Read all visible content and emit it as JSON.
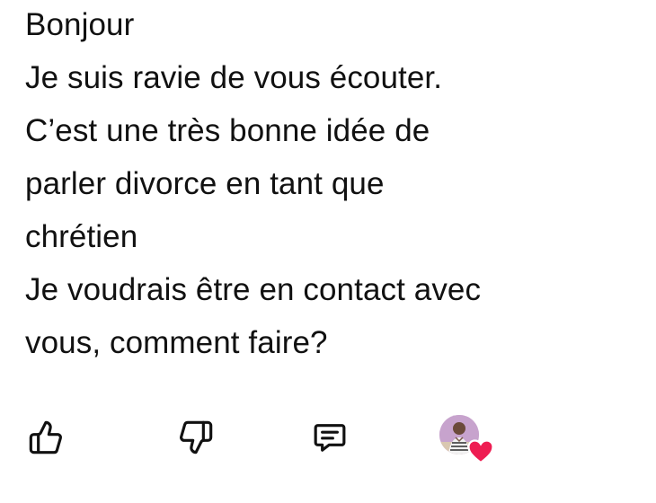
{
  "comment": {
    "lines": [
      "Bonjour",
      "Je suis ravie de vous écouter.",
      "C’est une très bonne idée de",
      "parler divorce en tant que",
      "chrétien",
      "Je voudrais être en contact avec",
      "vous, comment faire?"
    ]
  },
  "actions": {
    "like_icon": "thumbs-up-icon",
    "dislike_icon": "thumbs-down-icon",
    "reply_icon": "comment-icon",
    "creator_heart": "heart-icon",
    "heart_color": "#ee1d52"
  }
}
